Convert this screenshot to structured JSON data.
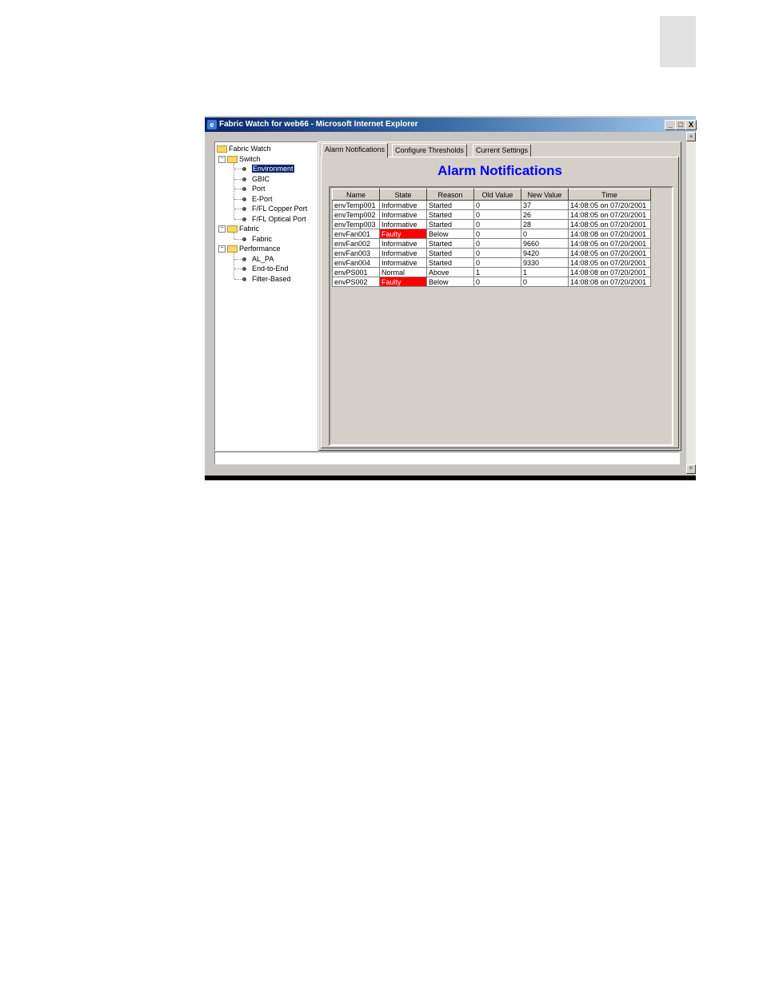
{
  "window": {
    "title": "Fabric Watch for web66 - Microsoft Internet Explorer",
    "controls": {
      "minimize": "_",
      "maximize": "□",
      "close": "X"
    }
  },
  "tree": {
    "root": "Fabric Watch",
    "groups": [
      {
        "label": "Switch",
        "items": [
          "Environment",
          "GBIC",
          "Port",
          "E-Port",
          "F/FL Copper Port",
          "F/FL Optical Port"
        ]
      },
      {
        "label": "Fabric",
        "items": [
          "Fabric"
        ]
      },
      {
        "label": "Performance",
        "items": [
          "AL_PA",
          "End-to-End",
          "Filter-Based"
        ]
      }
    ],
    "selected": "Environment"
  },
  "tabs": [
    "Alarm Notifications",
    "Configure Thresholds",
    "Current Settings"
  ],
  "active_tab": "Alarm Notifications",
  "heading": "Alarm Notifications",
  "table": {
    "columns": [
      "Name",
      "State",
      "Reason",
      "Old Value",
      "New Value",
      "Time"
    ],
    "rows": [
      [
        "envTemp001",
        "Informative",
        "Started",
        "0",
        "37",
        "14:08:05 on 07/20/2001"
      ],
      [
        "envTemp002",
        "Informative",
        "Started",
        "0",
        "26",
        "14:08:05 on 07/20/2001"
      ],
      [
        "envTemp003",
        "Informative",
        "Started",
        "0",
        "28",
        "14:08:05 on 07/20/2001"
      ],
      [
        "envFan001",
        "Faulty",
        "Below",
        "0",
        "0",
        "14:08:08 on 07/20/2001"
      ],
      [
        "envFan002",
        "Informative",
        "Started",
        "0",
        "9660",
        "14:08:05 on 07/20/2001"
      ],
      [
        "envFan003",
        "Informative",
        "Started",
        "0",
        "9420",
        "14:08:05 on 07/20/2001"
      ],
      [
        "envFan004",
        "Informative",
        "Started",
        "0",
        "9330",
        "14:08:05 on 07/20/2001"
      ],
      [
        "envPS001",
        "Normal",
        "Above",
        "1",
        "1",
        "14:08:08 on 07/20/2001"
      ],
      [
        "envPS002",
        "Faulty",
        "Below",
        "0",
        "0",
        "14:08:08 on 07/20/2001"
      ]
    ]
  },
  "colors": {
    "faulty": "#ff0000",
    "heading": "#0000ff",
    "selection": "#0a246a"
  }
}
